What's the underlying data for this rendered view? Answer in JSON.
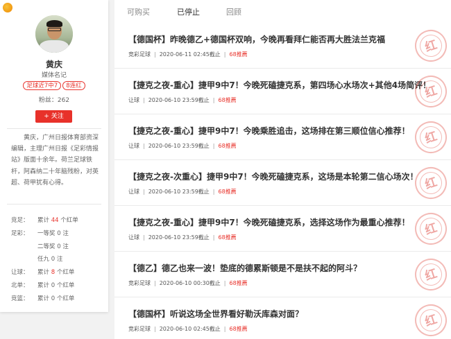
{
  "profile": {
    "name": "黄庆",
    "title": "媒体名记",
    "badges": [
      "足球近7中7",
      "8连红"
    ],
    "fans_label": "粉丝：262",
    "follow_label": "+ 关注",
    "bio": "黄庆，广州日报体育部资深编辑，主理广州日报《足彩情报站》版面十余年。荷兰足球铁杆，阿森纳二十年脑残粉，对英超、荷甲犹有心得。"
  },
  "stats": [
    {
      "label": "竞足：",
      "pre": "累计 ",
      "num": "44",
      "post": " 个红单",
      "num_red": true
    },
    {
      "label": "足彩：",
      "pre": "一等奖 ",
      "num": "0",
      "post": " 注",
      "num_red": false
    },
    {
      "label": "",
      "pre": "二等奖 ",
      "num": "0",
      "post": " 注",
      "num_red": false
    },
    {
      "label": "",
      "pre": "任九 ",
      "num": "0",
      "post": " 注",
      "num_red": false
    },
    {
      "label": "让球：",
      "pre": "累计 ",
      "num": "8",
      "post": " 个红单",
      "num_red": true
    },
    {
      "label": "北单：",
      "pre": "累计 ",
      "num": "0",
      "post": " 个红单",
      "num_red": false
    },
    {
      "label": "竞篮：",
      "pre": "累计 ",
      "num": "0",
      "post": " 个红单",
      "num_red": false
    }
  ],
  "tabs": [
    {
      "label": "可购买"
    },
    {
      "label": "已停止"
    },
    {
      "label": "回顾"
    }
  ],
  "items": [
    {
      "title": "【德国杯】昨晚德乙+德国杯双响，今晚再看拜仁能否再大胜法兰克福",
      "category": "竞彩足球",
      "time": "2020-06-11 02:45截止",
      "hit": "68推薦"
    },
    {
      "title": "【捷克之夜-重心】捷甲9中7！今晚死磕捷克系，第四场心水场次+其他4场简评！",
      "category": "让球",
      "time": "2020-06-10 23:59截止",
      "hit": "68推薦"
    },
    {
      "title": "【捷克之夜-重心】捷甲9中7！今晚乘胜追击，这场排在第三顺位信心推荐！",
      "category": "让球",
      "time": "2020-06-10 23:59截止",
      "hit": "68推薦"
    },
    {
      "title": "【捷克之夜-次重心】捷甲9中7！今晚死磕捷克系，这场是本轮第二信心场次！",
      "category": "让球",
      "time": "2020-06-10 23:59截止",
      "hit": "68推薦"
    },
    {
      "title": "【捷克之夜-重心】捷甲9中7！今晚死磕捷克系，选择这场作为最重心推荐！",
      "category": "让球",
      "time": "2020-06-10 23:59截止",
      "hit": "68推薦"
    },
    {
      "title": "【德乙】德乙也来一波！垫底的德累斯顿是不是扶不起的阿斗？",
      "category": "竞彩足球",
      "time": "2020-06-10 00:30截止",
      "hit": "68推薦"
    },
    {
      "title": "【德国杯】听说这场全世界看好勒沃库森对面？",
      "category": "竞彩足球",
      "time": "2020-06-10 02:45截止",
      "hit": "68推薦"
    }
  ],
  "stamp_text": "红",
  "colors": {
    "accent": "#e8312a",
    "text": "#333333",
    "muted": "#888888"
  }
}
